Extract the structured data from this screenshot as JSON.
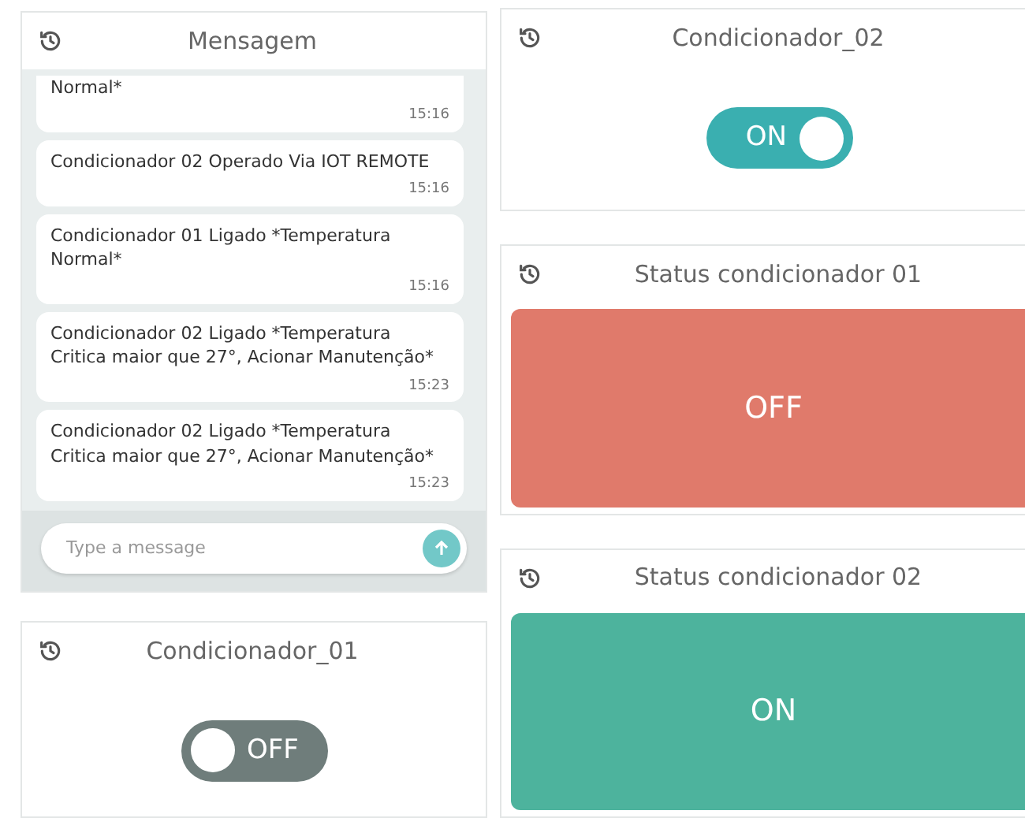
{
  "chat": {
    "title": "Mensagem",
    "messages": [
      {
        "text": "Normal*",
        "time": "15:16",
        "cut": true
      },
      {
        "text": "Condicionador 02 Operado Via IOT REMOTE",
        "time": "15:16",
        "cut": false
      },
      {
        "text": "Condicionador 01 Ligado *Temperatura Normal*",
        "time": "15:16",
        "cut": false
      },
      {
        "text": "Condicionador 02 Ligado *Temperatura Critica maior que 27°, Acionar Manutenção*",
        "time": "15:23",
        "cut": false
      },
      {
        "text": "Condicionador 02 Ligado *Temperatura Critica maior que 27°, Acionar Manutenção*",
        "time": "15:23",
        "cut": false
      }
    ],
    "input": {
      "placeholder": "Type a message"
    }
  },
  "left_widgets": [
    {
      "kind": "switch",
      "title": "Condicionador_01",
      "on": false,
      "label": "OFF"
    }
  ],
  "right_widgets": [
    {
      "kind": "switch",
      "title": "Condicionador_02",
      "on": true,
      "label": "ON"
    },
    {
      "kind": "status",
      "title": "Status condicionador 01",
      "on": false,
      "label": "OFF"
    },
    {
      "kind": "status",
      "title": "Status condicionador 02",
      "on": true,
      "label": "ON"
    }
  ]
}
